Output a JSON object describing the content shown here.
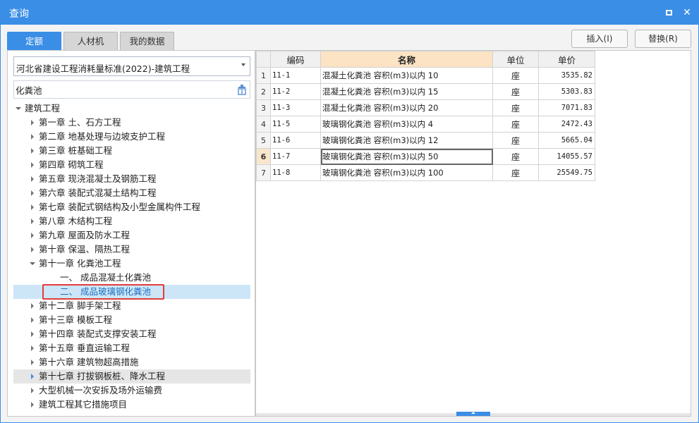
{
  "window": {
    "title": "查询"
  },
  "tabs": [
    "定额",
    "人材机",
    "我的数据"
  ],
  "buttons": {
    "insert": "插入(I)",
    "replace": "替换(R)"
  },
  "library": {
    "selected": "河北省建设工程消耗量标准(2022)-建筑工程"
  },
  "search": {
    "value": "化粪池"
  },
  "tree": [
    {
      "label": "建筑工程",
      "level": 0,
      "state": "expanded"
    },
    {
      "label": "第一章 土、石方工程",
      "level": 1,
      "state": "collapsed"
    },
    {
      "label": "第二章 地基处理与边坡支护工程",
      "level": 1,
      "state": "collapsed"
    },
    {
      "label": "第三章 桩基础工程",
      "level": 1,
      "state": "collapsed"
    },
    {
      "label": "第四章 砌筑工程",
      "level": 1,
      "state": "collapsed"
    },
    {
      "label": "第五章 现浇混凝土及钢筋工程",
      "level": 1,
      "state": "collapsed"
    },
    {
      "label": "第六章 装配式混凝土结构工程",
      "level": 1,
      "state": "collapsed"
    },
    {
      "label": "第七章 装配式钢结构及小型金属构件工程",
      "level": 1,
      "state": "collapsed"
    },
    {
      "label": "第八章 木结构工程",
      "level": 1,
      "state": "collapsed"
    },
    {
      "label": "第九章 屋面及防水工程",
      "level": 1,
      "state": "collapsed"
    },
    {
      "label": "第十章 保温、隔热工程",
      "level": 1,
      "state": "collapsed"
    },
    {
      "label": "第十一章 化粪池工程",
      "level": 1,
      "state": "expanded"
    },
    {
      "label": "一、 成品混凝土化粪池",
      "level": 2,
      "state": "leaf"
    },
    {
      "label": "二、 成品玻璃钢化粪池",
      "level": 2,
      "state": "leaf",
      "selected": true
    },
    {
      "label": "第十二章 脚手架工程",
      "level": 1,
      "state": "collapsed"
    },
    {
      "label": "第十三章 模板工程",
      "level": 1,
      "state": "collapsed"
    },
    {
      "label": "第十四章 装配式支撑安装工程",
      "level": 1,
      "state": "collapsed"
    },
    {
      "label": "第十五章 垂直运输工程",
      "level": 1,
      "state": "collapsed"
    },
    {
      "label": "第十六章 建筑物超高措施",
      "level": 1,
      "state": "collapsed"
    },
    {
      "label": "第十七章 打拔钢板桩、降水工程",
      "level": 1,
      "state": "collapsed",
      "hover": true
    },
    {
      "label": "大型机械一次安拆及场外运输费",
      "level": 1,
      "state": "collapsed"
    },
    {
      "label": "建筑工程其它措施项目",
      "level": 1,
      "state": "collapsed"
    }
  ],
  "table": {
    "headers": {
      "code": "编码",
      "name": "名称",
      "unit": "单位",
      "price": "单价"
    },
    "rows": [
      {
        "idx": "1",
        "code": "11-1",
        "name": "混凝土化粪池 容积(m3)以内 10",
        "unit": "座",
        "price": "3535.82"
      },
      {
        "idx": "2",
        "code": "11-2",
        "name": "混凝土化粪池 容积(m3)以内 15",
        "unit": "座",
        "price": "5303.83"
      },
      {
        "idx": "3",
        "code": "11-3",
        "name": "混凝土化粪池 容积(m3)以内 20",
        "unit": "座",
        "price": "7071.83"
      },
      {
        "idx": "4",
        "code": "11-5",
        "name": "玻璃钢化粪池 容积(m3)以内 4",
        "unit": "座",
        "price": "2472.43"
      },
      {
        "idx": "5",
        "code": "11-6",
        "name": "玻璃钢化粪池 容积(m3)以内 12",
        "unit": "座",
        "price": "5665.04"
      },
      {
        "idx": "6",
        "code": "11-7",
        "name": "玻璃钢化粪池 容积(m3)以内 50",
        "unit": "座",
        "price": "14055.57",
        "current": true
      },
      {
        "idx": "7",
        "code": "11-8",
        "name": "玻璃钢化粪池 容积(m3)以内 100",
        "unit": "座",
        "price": "25549.75"
      }
    ]
  }
}
